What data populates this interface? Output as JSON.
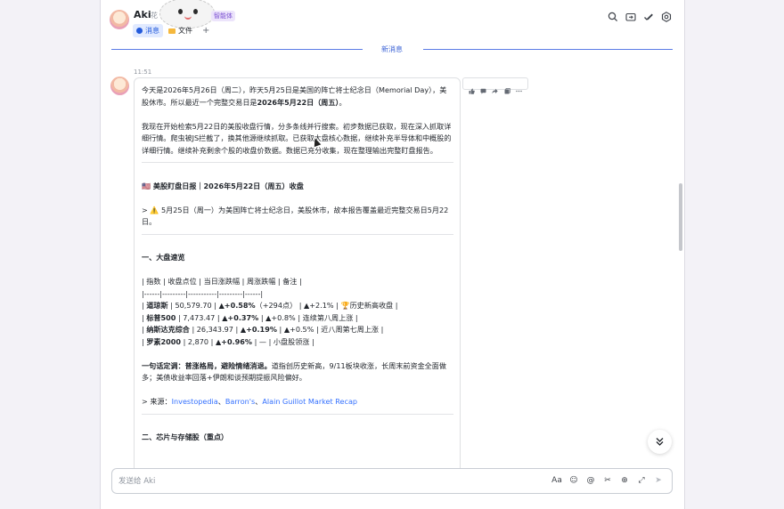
{
  "header": {
    "name": "Aki",
    "sub": "花",
    "badge": "智能体",
    "tabs": [
      {
        "label": "消息",
        "icon": "chat-icon"
      },
      {
        "label": "文件",
        "icon": "folder-icon"
      }
    ],
    "add_tab": "+",
    "actions": [
      "search-icon",
      "forward-icon",
      "check-icon",
      "settings-icon"
    ]
  },
  "divider": {
    "label": "新消息"
  },
  "message": {
    "time": "11:51",
    "intro1": "今天是2026年5月26日（周二），昨天5月25日是美国的阵亡将士纪念日（Memorial Day），美股休市。所以最近一个完整交易日是",
    "intro1_bold": "2026年5月22日（周五）",
    "intro1_end": "。",
    "intro2": "我现在开始检索5月22日的美股收盘行情，分多条线并行搜索。初步数据已获取，现在深入抓取详细行情。爬虫被JS拦截了，换其他源继续抓取。已获取大盘核心数据，继续补充半导体和中概股的详细行情。继续补充剩余个股的收盘价数据。数据已充分收集，现在整理输出完整盯盘报告。",
    "report_title": "🇺🇸 美股盯盘日报｜2026年5月22日（周五）收盘",
    "note": "> ⚠️ 5月25日（周一）为美国阵亡将士纪念日，美股休市，故本报告覆盖最近完整交易日5月22日。",
    "section1": "一、大盘速览",
    "table_header": "| 指数 | 收盘点位 | 当日涨跌幅 | 周涨跌幅 | 备注 |",
    "table_sep": "|------|---------|-----------|---------|------|",
    "rows": [
      {
        "name": "道琼斯",
        "close": "50,579.70",
        "day": "▲+0.58%",
        "day_extra": "（+294点）",
        "week": "▲+2.1%",
        "note": "🏆历史新高收盘"
      },
      {
        "name": "标普500",
        "close": "7,473.47",
        "day": "▲+0.37%",
        "day_extra": "",
        "week": "▲+0.8%",
        "note": "连续第八周上涨"
      },
      {
        "name": "纳斯达克综合",
        "close": "26,343.97",
        "day": "▲+0.19%",
        "day_extra": "",
        "week": "▲+0.5%",
        "note": "近八周第七周上涨"
      },
      {
        "name": "罗素2000",
        "close": "2,870",
        "day": "▲+0.96%",
        "day_extra": "",
        "week": "—",
        "note": "小盘股领涨"
      }
    ],
    "summary_bold": "一句话定调：普涨格局，避险情绪消退。",
    "summary": "道指创历史新高，9/11板块收涨，长周末前资金全面做多；美债收益率回落+伊朗和谈预期提振风险偏好。",
    "sources_prefix": "> 来源：",
    "sources": [
      "Investopedia",
      "Barron's",
      "Alain Guillot Market Recap"
    ],
    "sources_sep": "、",
    "section2": "二、芯片与存储股（重点）"
  },
  "composer": {
    "placeholder": "发送给 Aki"
  },
  "composer_tools": [
    "Aa",
    "☺",
    "@",
    "✂",
    "⊕",
    "⤢",
    "➤"
  ]
}
